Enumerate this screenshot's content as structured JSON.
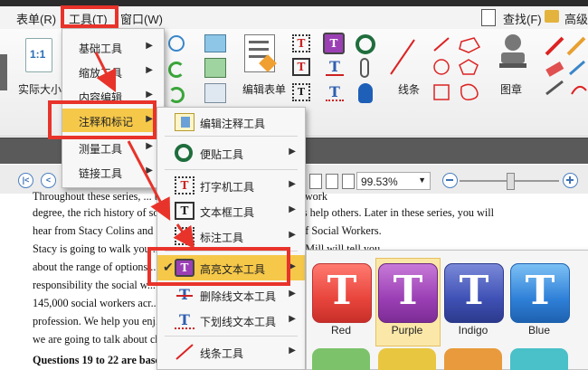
{
  "menubar": {
    "form": "表单(R)",
    "tools": "工具(T)",
    "window": "窗口(W)",
    "find": "查找(F)",
    "advanced": "高级"
  },
  "ribbon": {
    "actual_size_icon": "1:1",
    "actual_size_label": "实际大小",
    "edit_form": "编辑表单",
    "line": "线条",
    "stamp": "图章"
  },
  "tools_menu": {
    "items": [
      {
        "label": "基础工具"
      },
      {
        "label": "缩放工具"
      },
      {
        "label": "内容编辑"
      },
      {
        "label": "注释和标记"
      },
      {
        "label": "测量工具"
      },
      {
        "label": "链接工具"
      }
    ]
  },
  "annot_menu": {
    "items": [
      {
        "label": "编辑注释工具",
        "icon": "edit-annotation-icon"
      },
      {
        "label": "便贴工具",
        "icon": "sticky-note-icon"
      },
      {
        "label": "打字机工具",
        "icon": "typewriter-icon"
      },
      {
        "label": "文本框工具",
        "icon": "textbox-icon"
      },
      {
        "label": "标注工具",
        "icon": "callout-icon"
      },
      {
        "label": "高亮文本工具",
        "icon": "highlight-text-icon"
      },
      {
        "label": "删除线文本工具",
        "icon": "strikeout-icon"
      },
      {
        "label": "下划线文本工具",
        "icon": "underline-icon"
      },
      {
        "label": "线条工具",
        "icon": "line-tool-icon"
      }
    ]
  },
  "color_panel": {
    "glyph": "T",
    "tiles": [
      {
        "label": "Red",
        "color": "#e8453c"
      },
      {
        "label": "Purple",
        "color": "#9b3fb5"
      },
      {
        "label": "Indigo",
        "color": "#3f51b5"
      },
      {
        "label": "Blue",
        "color": "#2f80d8"
      }
    ]
  },
  "nav": {
    "zoom_value": "99.53%"
  },
  "document": {
    "lines": [
      "Throughout these series, ... the necessary steps to get a social work",
      "degree, the rich history of social work and how social workers help others. Later in these series, you will",
      "hear from Stacy Colins and ... rs at the National Association of Social Workers.",
      "Stacy is going to walk you ... f becoming a social worker and Mill will tell you",
      "about the range of options ...",
      "responsibility the social w...",
      "145,000 social workers acr...",
      "profession. We help you enj...",
      "we are going to talk about ch...",
      "Questions 19 to 22 are based"
    ]
  },
  "colors": {
    "accent_red": "#e8332b",
    "tile_red": "#e8453c",
    "tile_purple": "#9b3fb5",
    "tile_indigo": "#3f51b5",
    "tile_blue": "#2f80d8"
  }
}
